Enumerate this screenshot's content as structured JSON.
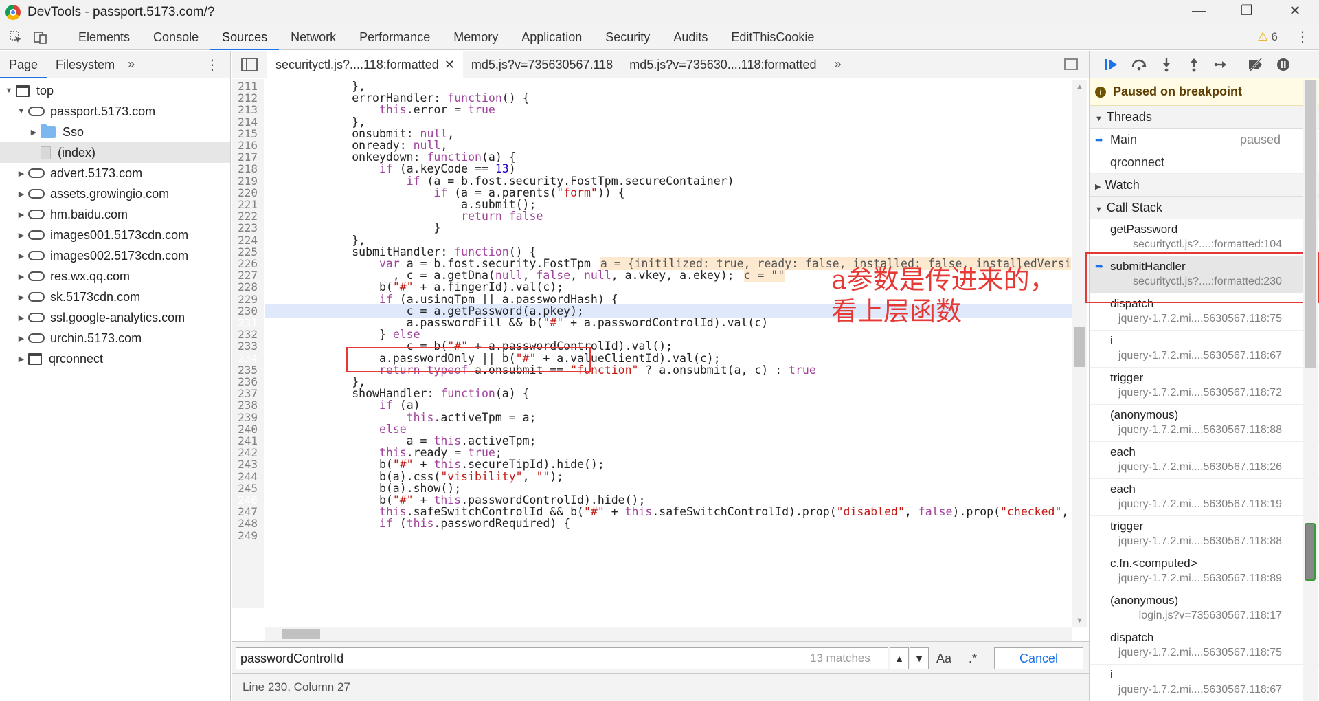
{
  "window": {
    "title": "DevTools - passport.5173.com/?",
    "minimize": "—",
    "maximize": "❐",
    "close": "✕"
  },
  "toolbar": {
    "tabs": [
      "Elements",
      "Console",
      "Sources",
      "Network",
      "Performance",
      "Memory",
      "Application",
      "Security",
      "Audits",
      "EditThisCookie"
    ],
    "active_tab": "Sources",
    "warnings_icon": "⚠",
    "warnings_count": "6"
  },
  "navigator": {
    "tabs": [
      "Page",
      "Filesystem"
    ],
    "more": "»",
    "tree": [
      {
        "label": "top",
        "type": "frame",
        "level": 0,
        "expanded": true
      },
      {
        "label": "passport.5173.com",
        "type": "cloud",
        "level": 1,
        "expanded": true
      },
      {
        "label": "Sso",
        "type": "folder",
        "level": 2,
        "expanded": false
      },
      {
        "label": "(index)",
        "type": "file",
        "level": 2,
        "selected": true
      },
      {
        "label": "advert.5173.com",
        "type": "cloud",
        "level": 1
      },
      {
        "label": "assets.growingio.com",
        "type": "cloud",
        "level": 1
      },
      {
        "label": "hm.baidu.com",
        "type": "cloud",
        "level": 1
      },
      {
        "label": "images001.5173cdn.com",
        "type": "cloud",
        "level": 1
      },
      {
        "label": "images002.5173cdn.com",
        "type": "cloud",
        "level": 1
      },
      {
        "label": "res.wx.qq.com",
        "type": "cloud",
        "level": 1
      },
      {
        "label": "sk.5173cdn.com",
        "type": "cloud",
        "level": 1
      },
      {
        "label": "ssl.google-analytics.com",
        "type": "cloud",
        "level": 1
      },
      {
        "label": "urchin.5173.com",
        "type": "cloud",
        "level": 1
      },
      {
        "label": "qrconnect",
        "type": "frame",
        "level": 1
      }
    ]
  },
  "editor": {
    "tabs": [
      {
        "label": "securityctl.js?....118:formatted",
        "active": true,
        "close": "✕"
      },
      {
        "label": "md5.js?v=735630567.118",
        "active": false
      },
      {
        "label": "md5.js?v=735630....118:formatted",
        "active": false
      }
    ],
    "more": "»",
    "lines": [
      {
        "n": "211",
        "t": "            },"
      },
      {
        "n": "212",
        "t": "            errorHandler: function() {"
      },
      {
        "n": "213",
        "t": "                this.error = true"
      },
      {
        "n": "214",
        "t": "            },"
      },
      {
        "n": "215",
        "t": "            onsubmit: null,"
      },
      {
        "n": "216",
        "t": "            onready: null,"
      },
      {
        "n": "217",
        "t": "            onkeydown: function(a) {"
      },
      {
        "n": "218",
        "t": "                if (a.keyCode == 13)"
      },
      {
        "n": "219",
        "t": "                    if (a = b.fost.security.FostTpm.secureContainer)"
      },
      {
        "n": "220",
        "t": "                        if (a = a.parents(\"form\")) {"
      },
      {
        "n": "221",
        "t": "                            a.submit();"
      },
      {
        "n": "222",
        "t": "                            return false"
      },
      {
        "n": "223",
        "t": "                        }"
      },
      {
        "n": "224",
        "t": "            },"
      },
      {
        "n": "225",
        "t": "            submitHandler: function() {"
      },
      {
        "n": "226",
        "t": "                var a = b.fost.security.FostTpm",
        "inline": "a = {initilized: true, ready: false, installed: false, installedVersi"
      },
      {
        "n": "227",
        "t": "                  , c = a.getDna(null, false, null, a.vkey, a.ekey);",
        "inline": "c = \"\""
      },
      {
        "n": "228",
        "t": "                b(\"#\" + a.fingerId).val(c);"
      },
      {
        "n": "229",
        "t": "                if (a.usingTpm || a.passwordHash) {"
      },
      {
        "n": "230",
        "t": "                    c = a.getPassword(a.pkey);",
        "hl": true
      },
      {
        "n": "231",
        "t": "                    a.passwordFill && b(\"#\" + a.passwordControlId).val(c)",
        "bp": true
      },
      {
        "n": "232",
        "t": "                } else"
      },
      {
        "n": "233",
        "t": "                    c = b(\"#\" + a.passwordControlId).val();"
      },
      {
        "n": "234",
        "t": "                a.passwordOnly || b(\"#\" + a.valueClientId).val(c);",
        "bp": true
      },
      {
        "n": "235",
        "t": "                return typeof a.onsubmit == \"function\" ? a.onsubmit(a, c) : true"
      },
      {
        "n": "236",
        "t": "            },"
      },
      {
        "n": "237",
        "t": "            showHandler: function(a) {"
      },
      {
        "n": "238",
        "t": "                if (a)"
      },
      {
        "n": "239",
        "t": "                    this.activeTpm = a;"
      },
      {
        "n": "240",
        "t": "                else"
      },
      {
        "n": "241",
        "t": "                    a = this.activeTpm;"
      },
      {
        "n": "242",
        "t": "                this.ready = true;"
      },
      {
        "n": "243",
        "t": "                b(\"#\" + this.secureTipId).hide();"
      },
      {
        "n": "244",
        "t": "                b(a).css(\"visibility\", \"\");"
      },
      {
        "n": "245",
        "t": "                b(a).show();"
      },
      {
        "n": "246",
        "t": "                b(\"#\" + this.passwordControlId).hide();",
        "bp": true
      },
      {
        "n": "247",
        "t": "                this.safeSwitchControlId && b(\"#\" + this.safeSwitchControlId).prop(\"disabled\", false).prop(\"checked\","
      },
      {
        "n": "248",
        "t": "                if (this.passwordRequired) {"
      },
      {
        "n": "249",
        "t": ""
      }
    ],
    "annotation_line1": "a参数是传进来的，",
    "annotation_line2": "看上层函数"
  },
  "search": {
    "query": "passwordControlId",
    "matches": "13 matches",
    "prev": "▲",
    "next": "▼",
    "case": "Aa",
    "regex": ".*",
    "cancel": "Cancel"
  },
  "status": {
    "position": "Line 230, Column 27"
  },
  "debugger": {
    "paused_label": "Paused on breakpoint",
    "threads_label": "Threads",
    "threads": [
      {
        "name": "Main",
        "state": "paused",
        "current": true
      },
      {
        "name": "qrconnect",
        "state": ""
      }
    ],
    "watch_label": "Watch",
    "callstack_label": "Call Stack",
    "frames": [
      {
        "fn": "getPassword",
        "loc": "securityctl.js?....:formatted:104"
      },
      {
        "fn": "submitHandler",
        "loc": "securityctl.js?....:formatted:230",
        "current": true
      },
      {
        "fn": "dispatch",
        "loc": "jquery-1.7.2.mi....5630567.118:75"
      },
      {
        "fn": "i",
        "loc": "jquery-1.7.2.mi....5630567.118:67"
      },
      {
        "fn": "trigger",
        "loc": "jquery-1.7.2.mi....5630567.118:72"
      },
      {
        "fn": "(anonymous)",
        "loc": "jquery-1.7.2.mi....5630567.118:88"
      },
      {
        "fn": "each",
        "loc": "jquery-1.7.2.mi....5630567.118:26"
      },
      {
        "fn": "each",
        "loc": "jquery-1.7.2.mi....5630567.118:19"
      },
      {
        "fn": "trigger",
        "loc": "jquery-1.7.2.mi....5630567.118:88"
      },
      {
        "fn": "c.fn.<computed>",
        "loc": "jquery-1.7.2.mi....5630567.118:89"
      },
      {
        "fn": "(anonymous)",
        "loc": "login.js?v=735630567.118:17"
      },
      {
        "fn": "dispatch",
        "loc": "jquery-1.7.2.mi....5630567.118:75"
      },
      {
        "fn": "i",
        "loc": "jquery-1.7.2.mi....5630567.118:67"
      }
    ]
  }
}
